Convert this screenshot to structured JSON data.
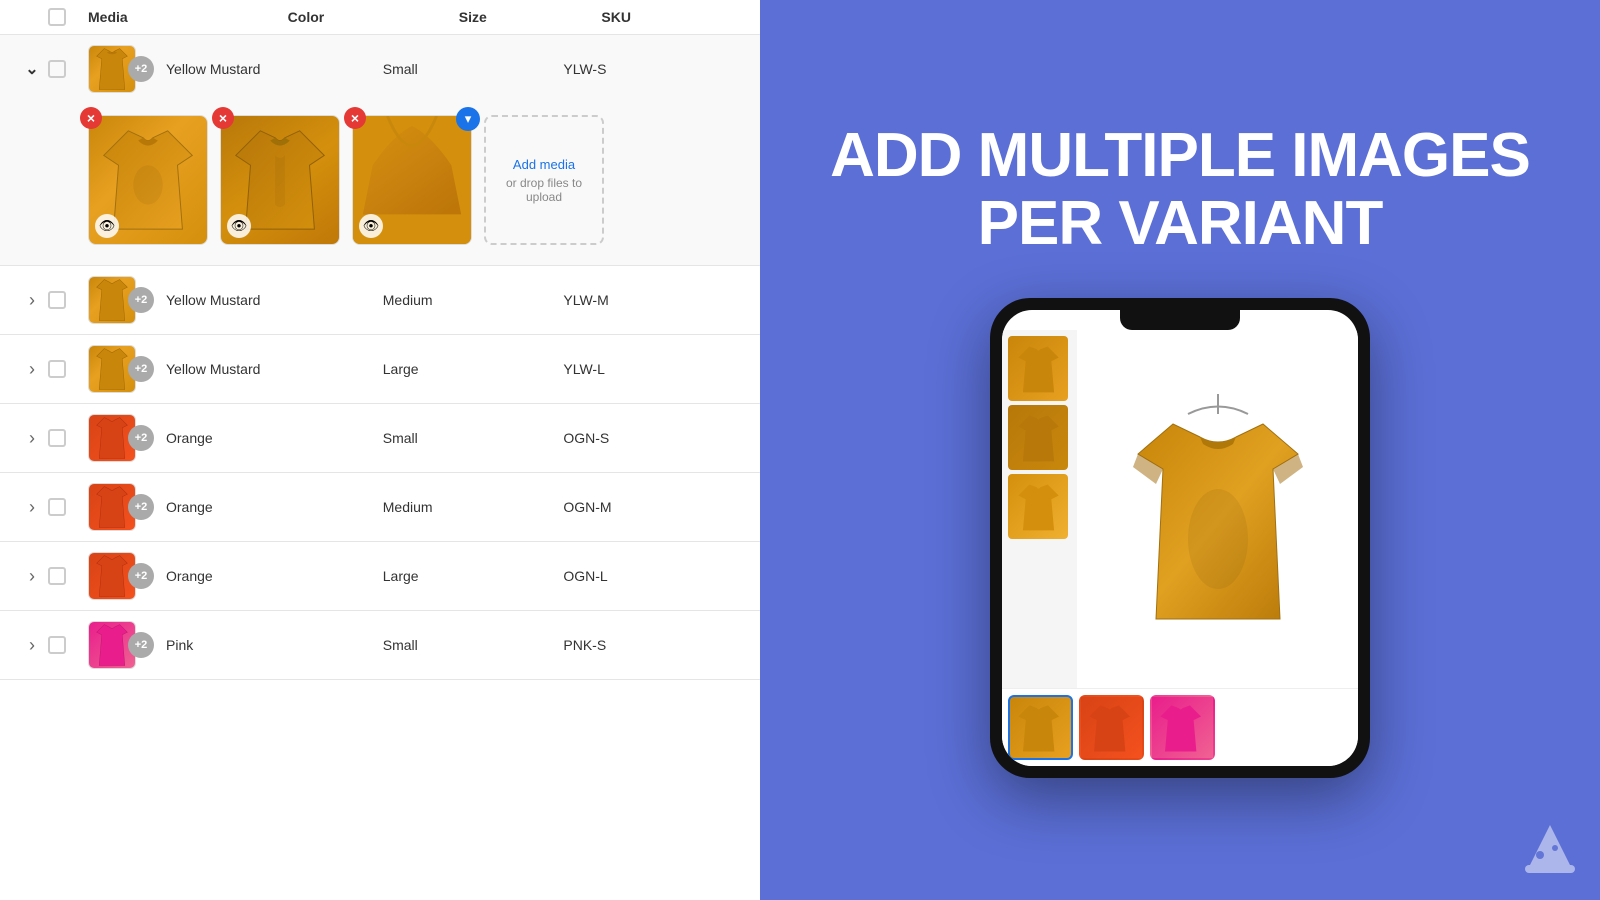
{
  "header": {
    "col_expand": "",
    "col_check": "",
    "col_media": "Media",
    "col_color": "Color",
    "col_size": "Size",
    "col_sku": "SKU"
  },
  "variants": [
    {
      "id": 1,
      "expanded": true,
      "color": "Yellow Mustard",
      "size": "Small",
      "sku": "YLW-S",
      "thumb_count": "+2",
      "images": [
        "mustard-front",
        "mustard-back",
        "mustard-detail"
      ]
    },
    {
      "id": 2,
      "expanded": false,
      "color": "Yellow Mustard",
      "size": "Medium",
      "sku": "YLW-M",
      "thumb_count": "+2"
    },
    {
      "id": 3,
      "expanded": false,
      "color": "Yellow Mustard",
      "size": "Large",
      "sku": "YLW-L",
      "thumb_count": "+2"
    },
    {
      "id": 4,
      "expanded": false,
      "color": "Orange",
      "size": "Small",
      "sku": "OGN-S",
      "thumb_count": "+2"
    },
    {
      "id": 5,
      "expanded": false,
      "color": "Orange",
      "size": "Medium",
      "sku": "OGN-M",
      "thumb_count": "+2"
    },
    {
      "id": 6,
      "expanded": false,
      "color": "Orange",
      "size": "Large",
      "sku": "OGN-L",
      "thumb_count": "+2"
    },
    {
      "id": 7,
      "expanded": false,
      "color": "Pink",
      "size": "Small",
      "sku": "PNK-S",
      "thumb_count": "+2"
    }
  ],
  "add_media": {
    "link_text": "Add media",
    "sub_text": "or drop files to upload"
  },
  "promo": {
    "title": "ADD MULTIPLE IMAGES PER VARIANT"
  }
}
